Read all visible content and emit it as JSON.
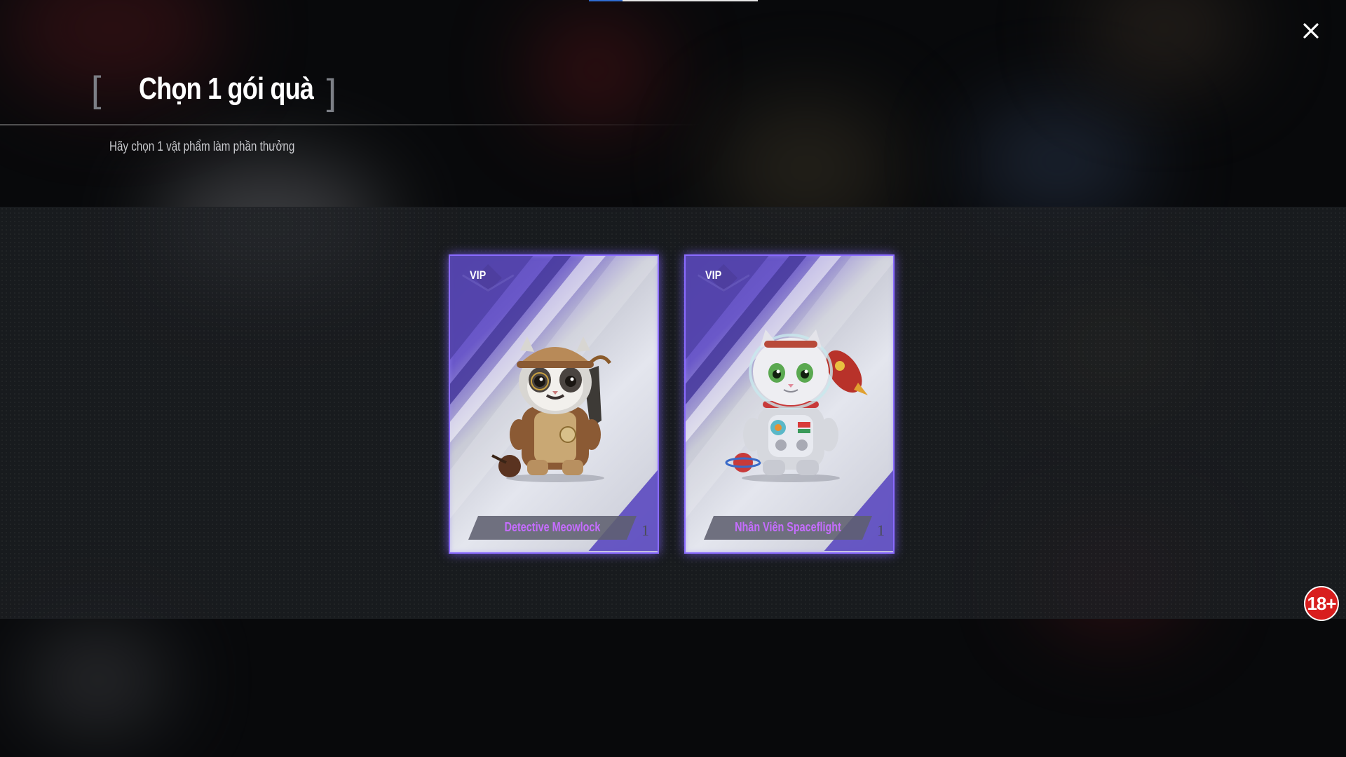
{
  "header": {
    "title": "Chọn 1 gói quà",
    "bracket_left": "[",
    "bracket_right": "]",
    "subtitle": "Hãy chọn 1 vật phẩm làm phần thưởng"
  },
  "close": {
    "icon": "close-icon"
  },
  "cards": [
    {
      "badge": "VIP",
      "name": "Detective Meowlock",
      "quantity": "1",
      "art_icon": "detective-cat-icon"
    },
    {
      "badge": "VIP",
      "name": "Nhân Viên Spaceflight",
      "quantity": "1",
      "art_icon": "astronaut-cat-icon"
    }
  ],
  "age_rating": "18+",
  "colors": {
    "accent_purple": "#8a6bff",
    "item_name": "#c66dff",
    "age_badge": "#d81e1e"
  }
}
